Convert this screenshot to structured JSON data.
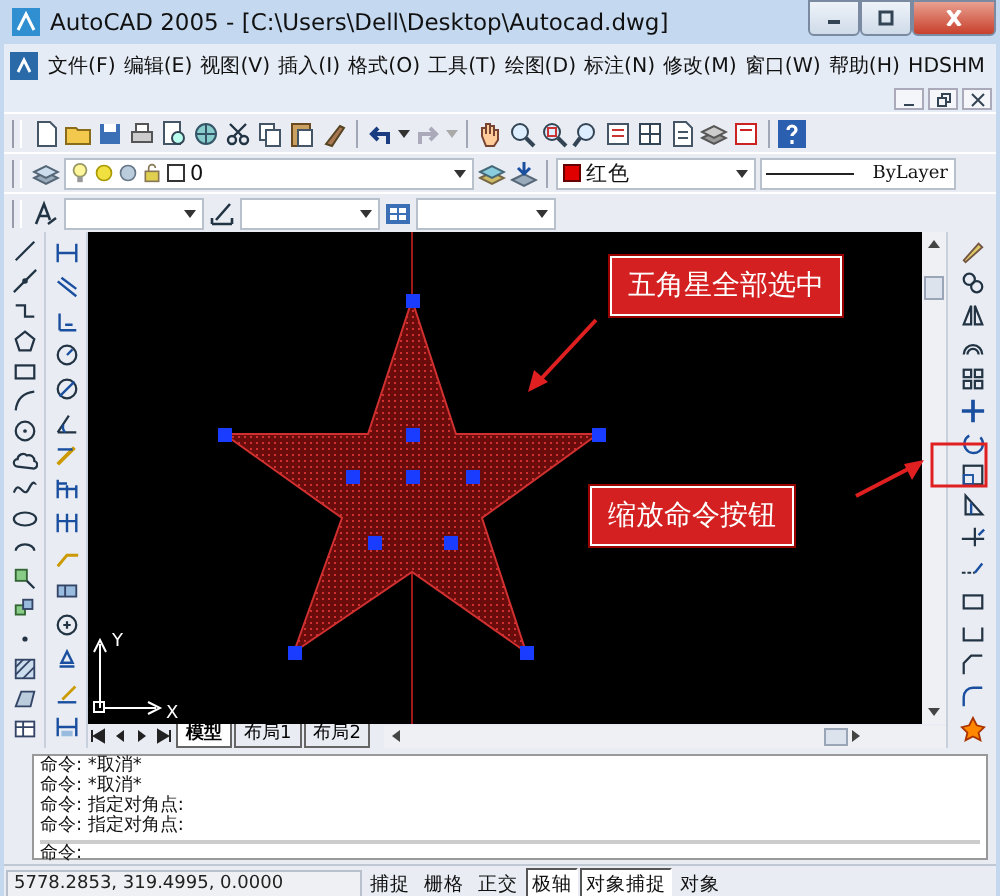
{
  "window": {
    "title": "AutoCAD 2005 - [C:\\Users\\Dell\\Desktop\\Autocad.dwg]"
  },
  "menu": [
    "文件(F)",
    "编辑(E)",
    "视图(V)",
    "插入(I)",
    "格式(O)",
    "工具(T)",
    "绘图(D)",
    "标注(N)",
    "修改(M)",
    "窗口(W)",
    "帮助(H)",
    "HDSHM"
  ],
  "layer_toolbar": {
    "layer": "0",
    "color_name": "红色",
    "linetype": "ByLayer"
  },
  "callouts": [
    {
      "text": "五角星全部选中"
    },
    {
      "text": "缩放命令按钮"
    }
  ],
  "ucs": {
    "x_label": "X",
    "y_label": "Y"
  },
  "layout_tabs": [
    {
      "label": "模型",
      "selected": true
    },
    {
      "label": "布局1",
      "selected": false
    },
    {
      "label": "布局2",
      "selected": false
    }
  ],
  "command_history": [
    "命令: *取消*",
    "命令: *取消*",
    "命令: 指定对角点:",
    "命令: 指定对角点:"
  ],
  "command_prompt": "命令:",
  "status_bar": {
    "coordinates": "5778.2853, 319.4995, 0.0000",
    "toggles": [
      {
        "label": "捕捉",
        "on": false
      },
      {
        "label": "栅格",
        "on": false
      },
      {
        "label": "正交",
        "on": false
      },
      {
        "label": "极轴",
        "on": true
      },
      {
        "label": "对象捕捉",
        "on": true
      },
      {
        "label": "对象",
        "on": false
      }
    ]
  }
}
